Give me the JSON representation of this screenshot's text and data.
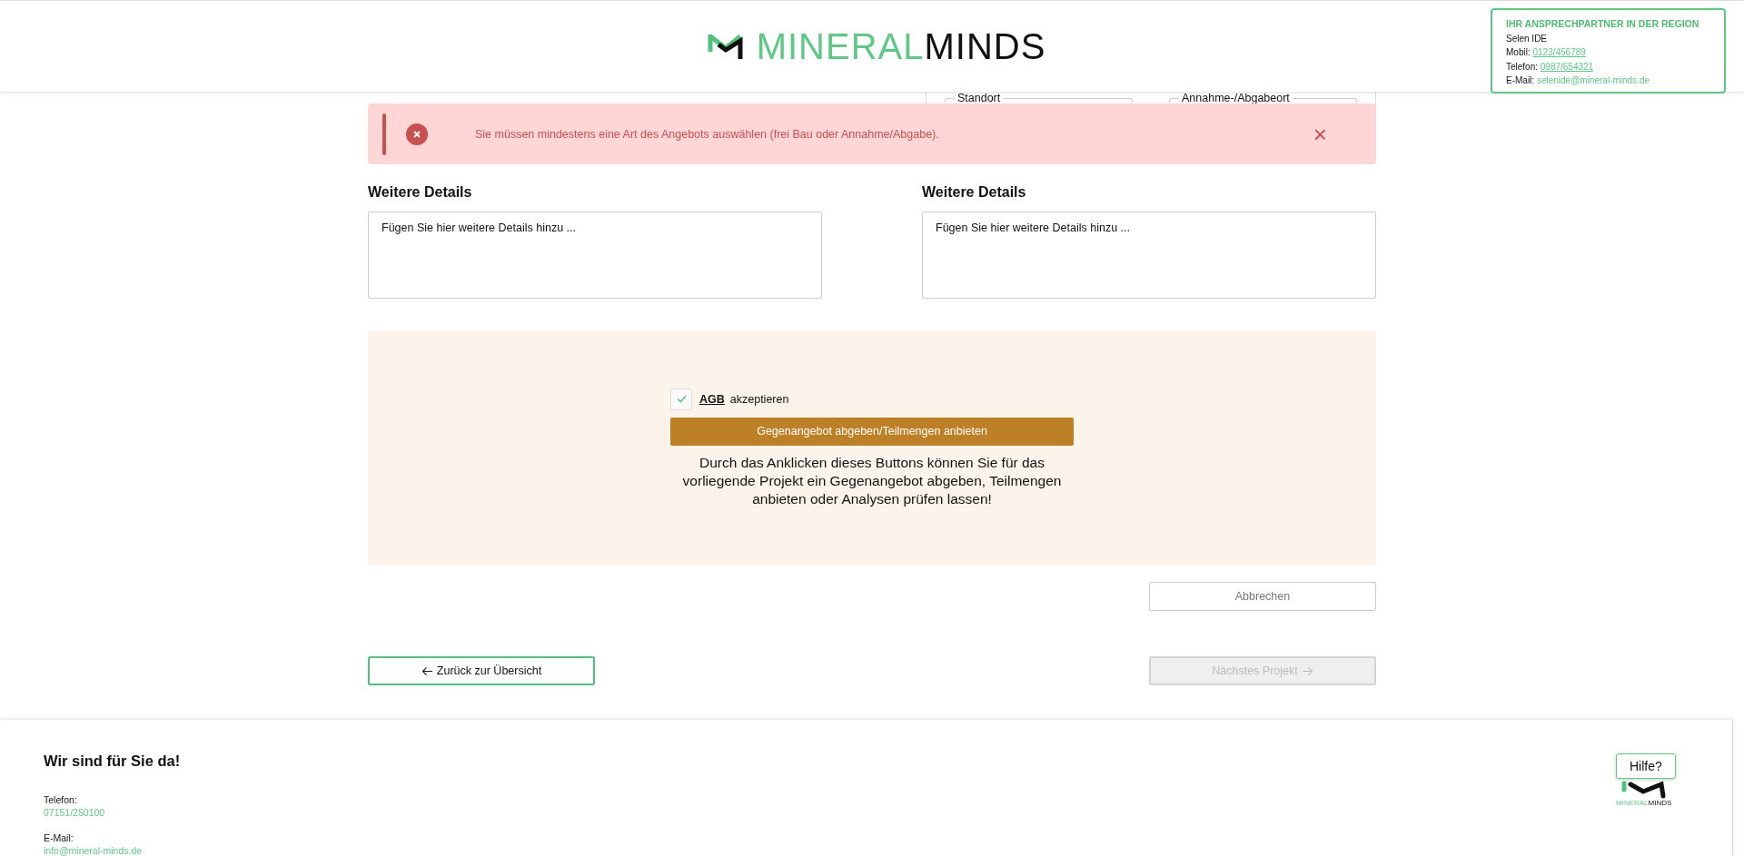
{
  "header": {
    "logo": {
      "part_1": "MINERAL",
      "part_2": "MINDS"
    },
    "contact": {
      "title": "IHR ANSPRECHPARTNER IN DER REGION",
      "name": "Selen IDE",
      "lines": [
        {
          "label": "Mobil:",
          "value": "0123/456789",
          "underlined": true
        },
        {
          "label": "Telefon:",
          "value": "0987/654321",
          "underlined": true
        },
        {
          "label": "E-Mail:",
          "value": "selenide@mineral-minds.de",
          "underlined": false
        }
      ]
    }
  },
  "location_card": {
    "fields": [
      "Standort",
      "Annahme-/Abgabeort"
    ]
  },
  "alert": {
    "message": "Sie müssen mindestens eine Art des Angebots auswählen (frei Bau oder Annahme/Abgabe).",
    "close": "×"
  },
  "details": [
    {
      "heading": "Weitere Details",
      "placeholder": "Fügen Sie hier weitere Details hinzu ..."
    },
    {
      "heading": "Weitere Details",
      "placeholder": "Fügen Sie hier weitere Details hinzu ..."
    }
  ],
  "offer_panel": {
    "agb": {
      "checked": true,
      "link": "AGB",
      "label": "akzeptieren"
    },
    "button": "Gegenangebot abgeben/Teilmengen anbieten",
    "note": "Durch das Anklicken dieses Buttons können Sie für das vorliegende Projekt ein Gegenangebot abgeben, Teilmengen anbieten oder Analysen prüfen lassen!"
  },
  "cancel_button": {
    "label": "Abbrechen"
  },
  "nav": {
    "back": {
      "label": "Zurück zur Übersicht",
      "disabled": false
    },
    "next": {
      "label": "Nächstes Projekt",
      "disabled": true
    }
  },
  "footer": {
    "heading": "Wir sind für Sie da!",
    "contacts": [
      {
        "label": "Telefon:",
        "value": "07151/250100"
      },
      {
        "label": "E-Mail:",
        "value": "info@mineral-minds.de"
      }
    ],
    "logo": {
      "part_1": "MINERAL",
      "part_2": "MINDS"
    },
    "help": "Hilfe?"
  }
}
